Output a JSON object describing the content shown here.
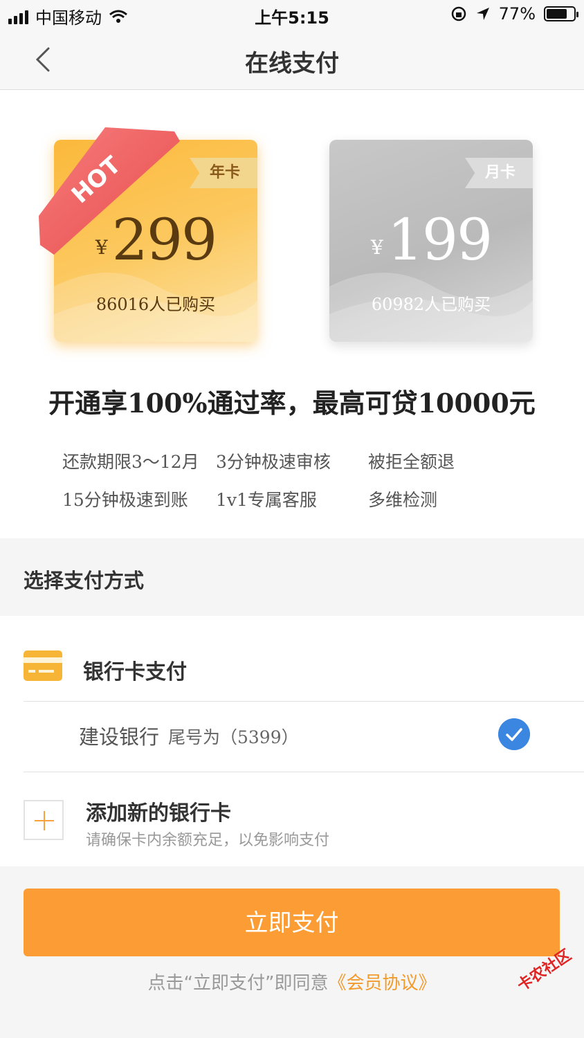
{
  "status_bar": {
    "carrier": "中国移动",
    "time": "上午5:15",
    "battery": "77%"
  },
  "nav": {
    "title": "在线支付"
  },
  "plans": [
    {
      "ribbon": "HOT",
      "tag": "年卡",
      "currency": "¥",
      "price": "299",
      "sold": "86016人已购买"
    },
    {
      "tag": "月卡",
      "currency": "¥",
      "price": "199",
      "sold": "60982人已购买"
    }
  ],
  "headline": "开通享100%通过率，最高可贷10000元",
  "features": [
    "还款期限3～12月",
    "3分钟极速审核",
    "被拒全额退",
    "15分钟极速到账",
    "1v1专属客服",
    "多维检测"
  ],
  "payment": {
    "section_title": "选择支付方式",
    "method_title": "银行卡支付",
    "bank_name": "建设银行",
    "bank_tail": "尾号为（5399）",
    "add_title": "添加新的银行卡",
    "add_sub": "请确保卡内余额充足，以免影响支付"
  },
  "footer": {
    "pay_button": "立即支付",
    "agree_prefix": "点击“立即支付”即同意",
    "agree_link": "《会员协议》"
  },
  "watermark": "卡农社区",
  "colors": {
    "accent": "#fb9d34",
    "gold": "#fbb93c",
    "check": "#3a86e0"
  }
}
